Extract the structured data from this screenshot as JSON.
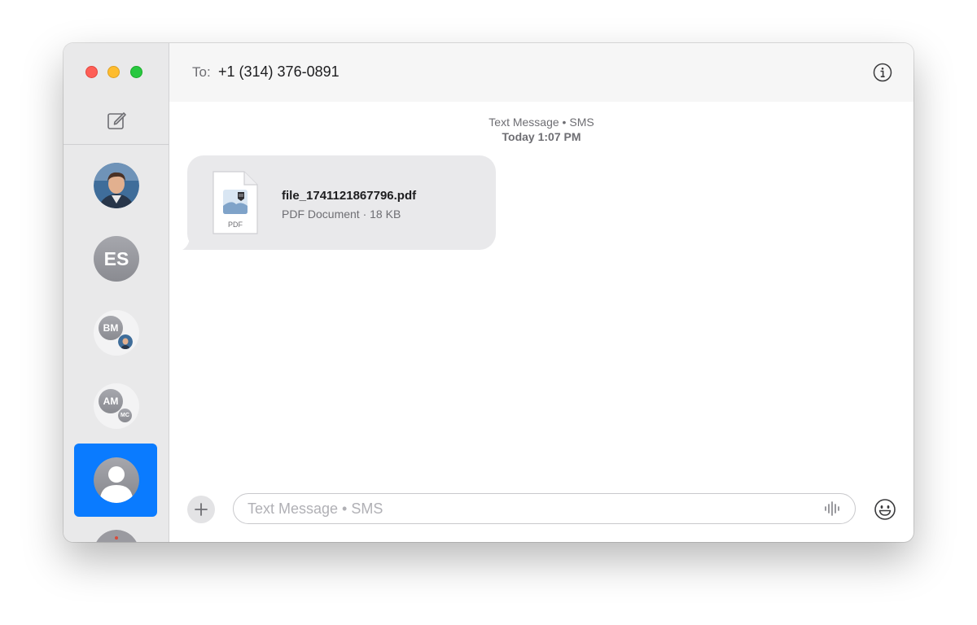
{
  "window": {
    "traffic_lights": [
      "close",
      "minimize",
      "maximize"
    ],
    "colors": {
      "close": "#fe5f57",
      "minimize": "#febc2e",
      "maximize": "#28c840",
      "selection": "#0a7bff"
    }
  },
  "sidebar": {
    "compose_icon": "compose-icon",
    "conversations": [
      {
        "type": "photo",
        "icon": "contact-photo"
      },
      {
        "type": "initials",
        "initials": "ES"
      },
      {
        "type": "group",
        "initials": "BM",
        "secondary": "photo"
      },
      {
        "type": "group",
        "initials": "AM",
        "secondary": "MC"
      },
      {
        "type": "unknown-contact",
        "icon": "person-icon",
        "selected": true
      },
      {
        "type": "photo",
        "partially_visible": true
      }
    ]
  },
  "header": {
    "to_label": "To:",
    "recipient": "+1 (314) 376-0891",
    "info_icon": "info-icon"
  },
  "thread": {
    "service": "Text Message • SMS",
    "timestamp": "Today 1:07 PM",
    "messages": [
      {
        "direction": "incoming",
        "kind": "file",
        "file_name": "file_1741121867796.pdf",
        "file_meta": "PDF Document · 18 KB",
        "file_badge": "PDF"
      }
    ]
  },
  "composer": {
    "placeholder": "Text Message • SMS",
    "value": "",
    "plus_icon": "plus-icon",
    "audio_icon": "waveform-icon",
    "emoji_icon": "emoji-icon"
  }
}
